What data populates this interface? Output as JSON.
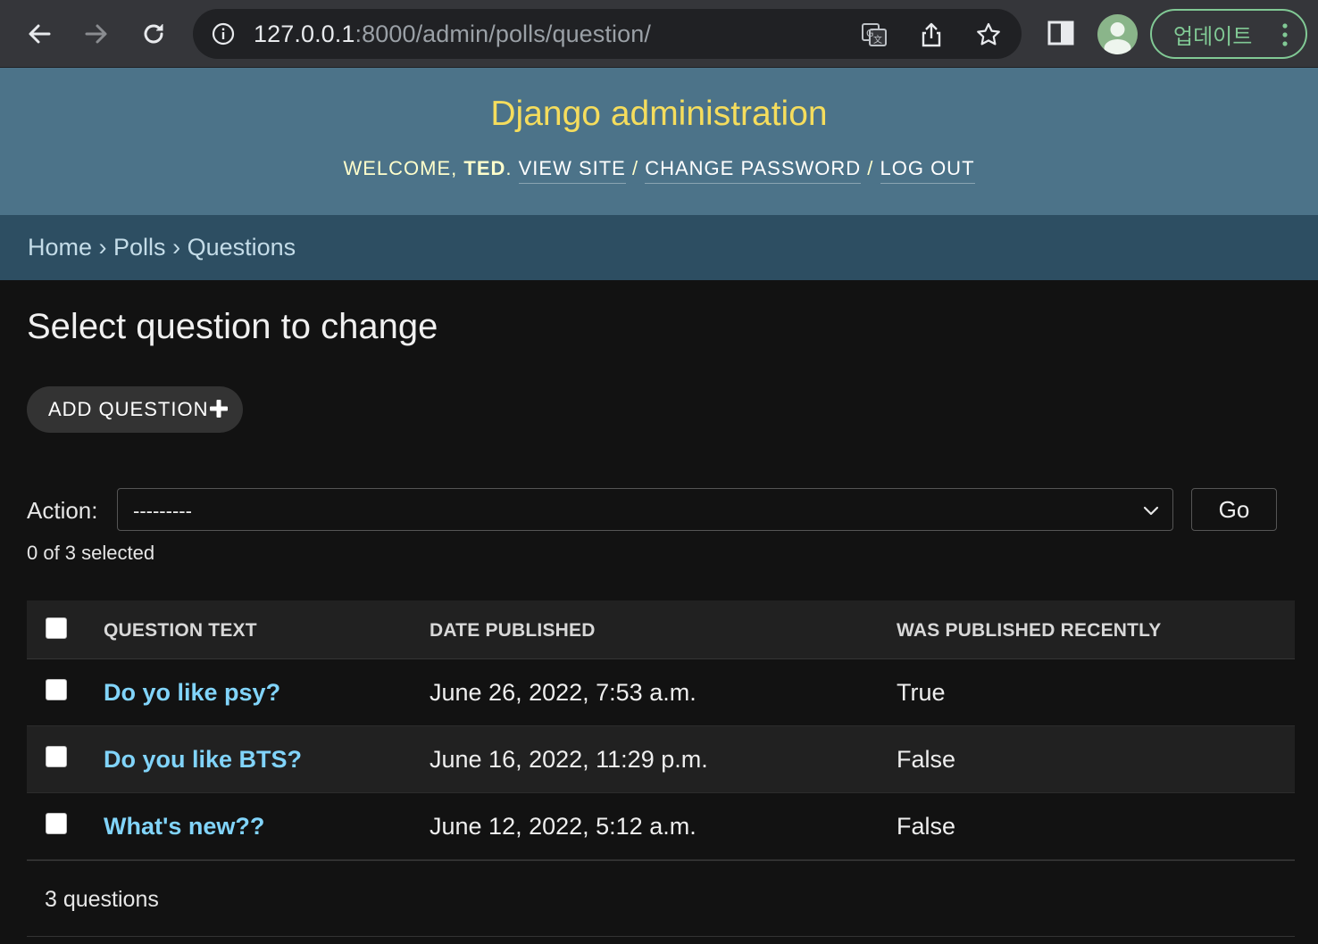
{
  "browser": {
    "url_host": "127.0.0.1",
    "url_rest": ":8000/admin/polls/question/",
    "update_label": "업데이트"
  },
  "header": {
    "site_name": "Django administration",
    "welcome": "Welcome, ",
    "username": "Ted",
    "view_site": "View site",
    "change_password": "Change password",
    "log_out": "Log out",
    "sep": " / "
  },
  "breadcrumbs": {
    "home": "Home",
    "polls": "Polls",
    "current": "Questions",
    "sep": " › "
  },
  "main": {
    "title": "Select question to change",
    "add_label": "ADD QUESTION",
    "action_label": "Action:",
    "action_value": "---------",
    "go_label": "Go",
    "selected_count": "0 of 3 selected",
    "columns": [
      "QUESTION TEXT",
      "DATE PUBLISHED",
      "WAS PUBLISHED RECENTLY"
    ],
    "rows": [
      {
        "question": "Do yo like psy?",
        "date": "June 26, 2022, 7:53 a.m.",
        "recent": "True"
      },
      {
        "question": "Do you like BTS?",
        "date": "June 16, 2022, 11:29 p.m.",
        "recent": "False"
      },
      {
        "question": "What's new??",
        "date": "June 12, 2022, 5:12 a.m.",
        "recent": "False"
      }
    ],
    "paginator": "3 questions"
  },
  "colors": {
    "header_bg": "#4c7389",
    "site_name": "#f5dd5d",
    "breadcrumbs_bg": "#2d4e62",
    "link": "#81d4fa"
  }
}
